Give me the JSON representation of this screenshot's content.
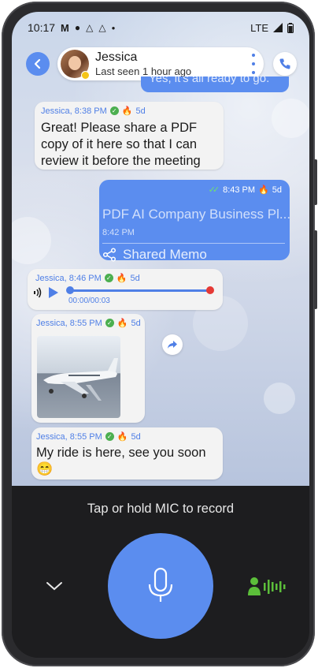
{
  "status_bar": {
    "time": "10:17",
    "network": "LTE"
  },
  "header": {
    "contact_name": "Jessica",
    "last_seen": "Last seen 1 hour ago"
  },
  "messages": [
    {
      "type": "text",
      "direction": "out",
      "text": "Yes, it's all ready to go.",
      "partial": true
    },
    {
      "type": "text",
      "direction": "in",
      "sender_time": "Jessica, 8:38 PM",
      "expiry": "5d",
      "text_lines": [
        "Great! Please share a PDF",
        "copy of it here so that I can",
        "review it before the meeting"
      ]
    },
    {
      "type": "document",
      "direction": "out",
      "time": "8:43 PM",
      "expiry": "5d",
      "title": "PDF AI Company Business Pl...",
      "doc_time": "8:42 PM",
      "action": "Shared Memo"
    },
    {
      "type": "voice",
      "direction": "in",
      "sender_time": "Jessica, 8:46 PM",
      "expiry": "5d",
      "duration": "00:00/00:03"
    },
    {
      "type": "image",
      "direction": "in",
      "sender_time": "Jessica, 8:55 PM",
      "expiry": "5d"
    },
    {
      "type": "text",
      "direction": "in",
      "sender_time": "Jessica, 8:55 PM",
      "expiry": "5d",
      "text": "My ride is here, see you soon",
      "emoji": "😁"
    }
  ],
  "input_panel": {
    "hint": "Tap or hold MIC to record"
  },
  "colors": {
    "accent": "#5b8def",
    "panel": "#1d1d1f",
    "online": "#4caf50",
    "fire": "#f07a2a",
    "record": "#e53935"
  }
}
